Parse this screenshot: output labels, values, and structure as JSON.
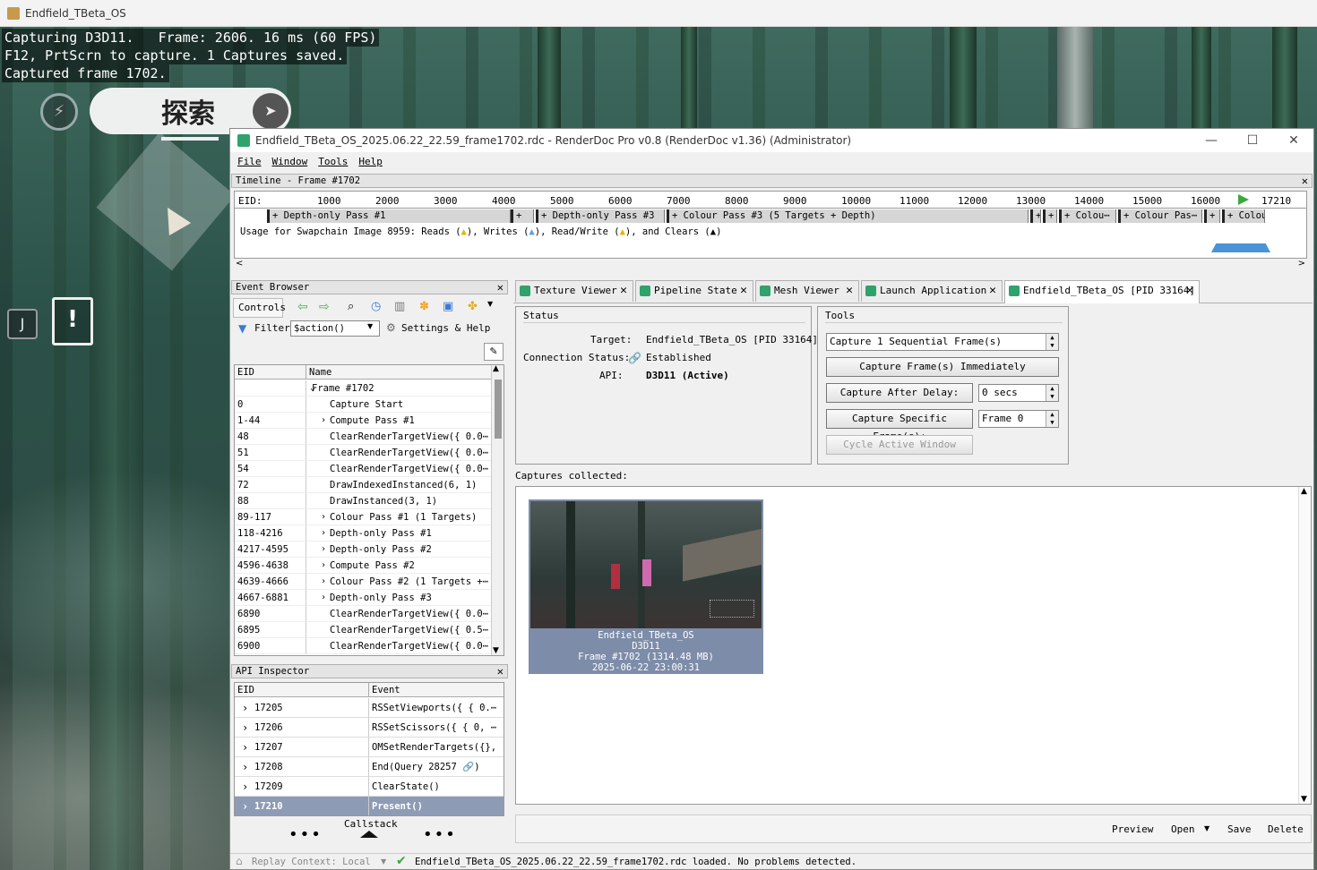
{
  "outer": {
    "title": "Endfield_TBeta_OS"
  },
  "overlay": {
    "line1": "Capturing D3D11.   Frame: 2606. 16 ms (60 FPS)",
    "line2": "F12, PrtScrn to capture. 1 Captures saved.",
    "line3": "Captured frame 1702.",
    "explore_label": "探索",
    "key_hint": "J"
  },
  "window": {
    "title": "Endfield_TBeta_OS_2025.06.22_22.59_frame1702.rdc - RenderDoc Pro v0.8 (RenderDoc v1.36) (Administrator)",
    "minimize": "—",
    "maximize": "☐",
    "close": "✕"
  },
  "menu": [
    "File",
    "Window",
    "Tools",
    "Help"
  ],
  "timeline": {
    "header": "Timeline - Frame #1702",
    "eid_label": "EID:",
    "ticks": [
      "1000",
      "2000",
      "3000",
      "4000",
      "5000",
      "6000",
      "7000",
      "8000",
      "9000",
      "10000",
      "11000",
      "12000",
      "13000",
      "14000",
      "15000",
      "16000"
    ],
    "current": "17210",
    "passes": [
      "+ Depth-only Pass #1",
      "+",
      "+ Depth-only Pass #3",
      "+ Colour Pass #3 (5 Targets + Depth)",
      "+",
      "+",
      "+ Colou⋯",
      "+ Colour Pas⋯",
      "+",
      "+ Colou⋯"
    ],
    "usage": {
      "prefix": "Usage for Swapchain Image 8959: Reads (",
      "reads_close": "), Writes (",
      "writes_close": "), Read/Write (",
      "rw_close": "), and Clears (",
      "end": ")"
    }
  },
  "event_browser": {
    "header": "Event Browser",
    "controls_label": "Controls",
    "filter_label": "Filter",
    "filter_value": "$action()",
    "settings_label": "Settings & Help",
    "col_eid": "EID",
    "col_name": "Name",
    "rows": [
      {
        "eid": "",
        "name": "Frame #1702",
        "arrow": "down",
        "indent": 0
      },
      {
        "eid": "0",
        "name": "Capture Start",
        "arrow": "",
        "indent": 1
      },
      {
        "eid": "1-44",
        "name": "Compute Pass #1",
        "arrow": "right",
        "indent": 1
      },
      {
        "eid": "48",
        "name": "ClearRenderTargetView({ 0.0⋯",
        "arrow": "",
        "indent": 1
      },
      {
        "eid": "51",
        "name": "ClearRenderTargetView({ 0.0⋯",
        "arrow": "",
        "indent": 1
      },
      {
        "eid": "54",
        "name": "ClearRenderTargetView({ 0.0⋯",
        "arrow": "",
        "indent": 1
      },
      {
        "eid": "72",
        "name": "DrawIndexedInstanced(6, 1)",
        "arrow": "",
        "indent": 1
      },
      {
        "eid": "88",
        "name": "DrawInstanced(3, 1)",
        "arrow": "",
        "indent": 1
      },
      {
        "eid": "89-117",
        "name": "Colour Pass #1 (1 Targets)",
        "arrow": "right",
        "indent": 1
      },
      {
        "eid": "118-4216",
        "name": "Depth-only Pass #1",
        "arrow": "right",
        "indent": 1
      },
      {
        "eid": "4217-4595",
        "name": "Depth-only Pass #2",
        "arrow": "right",
        "indent": 1
      },
      {
        "eid": "4596-4638",
        "name": "Compute Pass #2",
        "arrow": "right",
        "indent": 1
      },
      {
        "eid": "4639-4666",
        "name": "Colour Pass #2 (1 Targets +⋯",
        "arrow": "right",
        "indent": 1
      },
      {
        "eid": "4667-6881",
        "name": "Depth-only Pass #3",
        "arrow": "right",
        "indent": 1
      },
      {
        "eid": "6890",
        "name": "ClearRenderTargetView({ 0.0⋯",
        "arrow": "",
        "indent": 1
      },
      {
        "eid": "6895",
        "name": "ClearRenderTargetView({ 0.5⋯",
        "arrow": "",
        "indent": 1
      },
      {
        "eid": "6900",
        "name": "ClearRenderTargetView({ 0.0⋯",
        "arrow": "",
        "indent": 1
      }
    ]
  },
  "api_inspector": {
    "header": "API Inspector",
    "col_eid": "EID",
    "col_event": "Event",
    "rows": [
      {
        "eid": "17205",
        "event": "RSSetViewports({ { 0.⋯",
        "selected": false
      },
      {
        "eid": "17206",
        "event": "RSSetScissors({ { 0, ⋯",
        "selected": false
      },
      {
        "eid": "17207",
        "event": "OMSetRenderTargets({},",
        "selected": false
      },
      {
        "eid": "17208",
        "event": "End(Query 28257 🔗)",
        "selected": false
      },
      {
        "eid": "17209",
        "event": "ClearState()",
        "selected": false
      },
      {
        "eid": "17210",
        "event": "Present()",
        "selected": true
      }
    ],
    "callstack_label": "Callstack"
  },
  "tabs": [
    {
      "label": "Texture Viewer"
    },
    {
      "label": "Pipeline State"
    },
    {
      "label": "Mesh Viewer"
    },
    {
      "label": "Launch Application"
    },
    {
      "label": "Endfield_TBeta_OS [PID 33164]"
    }
  ],
  "status": {
    "header": "Status",
    "target_label": "Target:",
    "target_value": "Endfield_TBeta_OS [PID 33164]",
    "conn_label": "Connection Status:",
    "conn_value": "Established",
    "api_label": "API:",
    "api_value": "D3D11 (Active)"
  },
  "tools": {
    "header": "Tools",
    "sequential_value": "Capture 1 Sequential Frame(s)",
    "capture_now": "Capture Frame(s) Immediately",
    "capture_delay": "Capture After Delay:",
    "delay_value": "0 secs",
    "capture_specific": "Capture Specific Frame(s):",
    "frame_value": "Frame 0",
    "cycle": "Cycle Active Window"
  },
  "captures": {
    "label": "Captures collected:",
    "item": {
      "name": "Endfield_TBeta_OS",
      "api": "D3D11",
      "frame": "Frame #1702 (1314.48 MB)",
      "time": "2025-06-22 23:00:31"
    },
    "buttons": {
      "preview": "Preview",
      "open": "Open",
      "save": "Save",
      "delete": "Delete"
    }
  },
  "statusbar": {
    "replay": "Replay Context: Local",
    "message": "Endfield_TBeta_OS_2025.06.22_22.59_frame1702.rdc loaded. No problems detected."
  },
  "colors": {
    "accent": "#2fa36b",
    "selected_row": "#8e9bb5",
    "thumb_bg": "#7d8ca8"
  }
}
